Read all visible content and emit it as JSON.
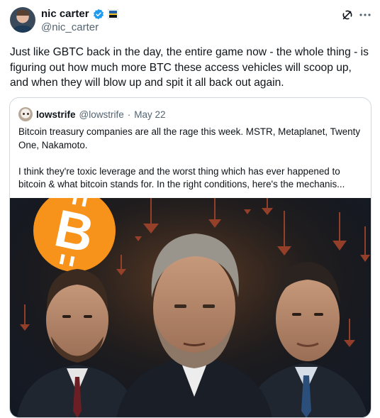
{
  "author": {
    "display_name": "nic carter",
    "handle": "@nic_carter"
  },
  "tweet": {
    "text": "Just like GBTC back in the day, the entire game now - the whole thing - is figuring out how much more BTC these access vehicles will scoop up, and when they will blow up and spit it all back out again."
  },
  "quote": {
    "display_name": "lowstrife",
    "handle": "@lowstrife",
    "separator": "·",
    "date": "May 22",
    "text_line1": "Bitcoin treasury companies are all the rage this week. MSTR, Metaplanet, Twenty One, Nakamoto.",
    "text_line2": "I think they're toxic leverage and the worst thing which has ever happened to bitcoin & what bitcoin stands for. In the right conditions, here's the mechanis..."
  },
  "icons": {
    "verified": "verified-badge-icon",
    "affiliate": "affiliate-flag-icon",
    "grok": "grok-icon",
    "more": "more-icon",
    "bitcoin": "bitcoin-logo-icon"
  },
  "colors": {
    "verified_blue": "#1d9bf0",
    "text": "#0f1419",
    "muted": "#536471",
    "border": "#cfd9de",
    "bitcoin_orange": "#f7931a"
  }
}
